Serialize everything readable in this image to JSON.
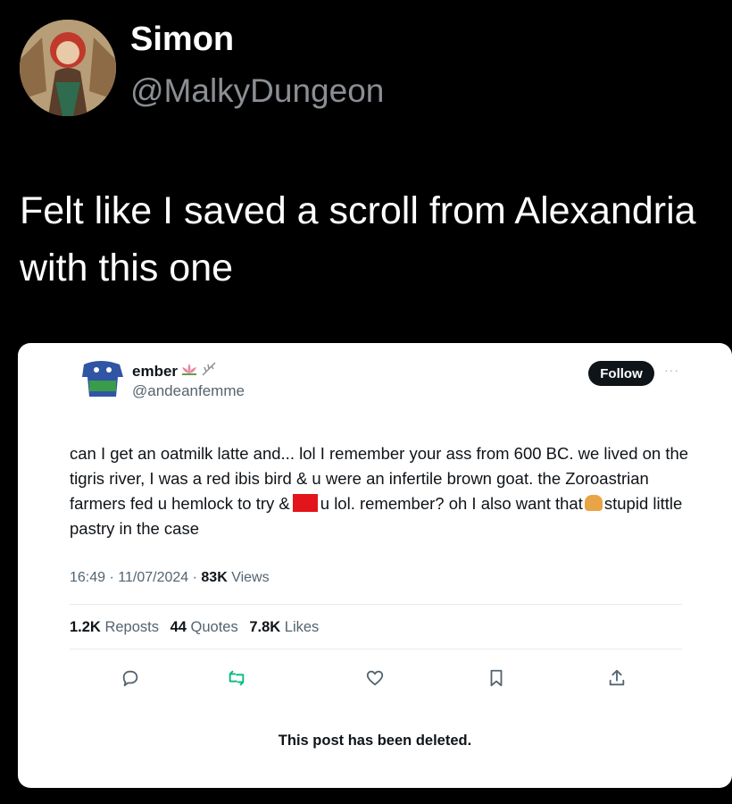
{
  "outer_tweet": {
    "name": "Simon",
    "handle": "@MalkyDungeon",
    "text": "Felt like I saved a scroll from Alexandria with this one"
  },
  "quoted_tweet": {
    "name": "ember",
    "name_emojis": [
      "lotus-icon",
      "feather-icon"
    ],
    "handle": "@andeanfemme",
    "follow_label": "Follow",
    "more_label": "···",
    "body_part1": "can I get an oatmilk latte and... lol I remember your ass from 600 BC. we lived on the tigris river, I was a red ibis bird & u were an infertile brown goat. the Zoroastrian farmers fed u hemlock to try &",
    "body_part2": "u lol. remember? oh I also want that",
    "body_part3": "stupid little pastry in the case",
    "time": "16:49",
    "date": "11/07/2024",
    "views_count": "83K",
    "views_label": "Views",
    "reposts_count": "1.2K",
    "reposts_label": "Reposts",
    "quotes_count": "44",
    "quotes_label": "Quotes",
    "likes_count": "7.8K",
    "likes_label": "Likes",
    "actions": [
      "reply-icon",
      "repost-icon",
      "like-icon",
      "bookmark-icon",
      "share-icon"
    ],
    "deleted_notice": "This post has been deleted.",
    "colors": {
      "repost_green": "#00ba7c",
      "redaction_red": "#e4141b"
    }
  }
}
